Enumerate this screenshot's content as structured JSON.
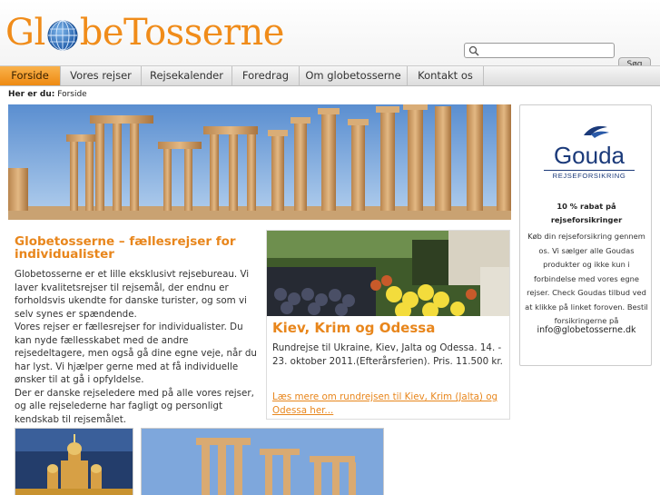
{
  "header": {
    "logo_text_left": "Gl",
    "logo_text_right": "beTosserne",
    "search_placeholder": "",
    "search_button": "Søg"
  },
  "nav": {
    "items": [
      "Forside",
      "Vores rejser",
      "Rejsekalender",
      "Foredrag",
      "Om globetosserne",
      "Kontakt os"
    ]
  },
  "breadcrumb": {
    "label": "Her er du:",
    "current": "Forside"
  },
  "intro": {
    "title": "Globetosserne – fællesrejser for individualister",
    "p1": "Globetosserne er et lille eksklusivt rejsebureau. Vi laver kvalitetsrejser til rejsemål, der endnu er forholdsvis ukendte for danske turister, og som vi selv synes er spændende.",
    "p2": "Vores rejser er fællesrejser for individualister. Du kan nyde fællesskabet med de andre rejsedeltagere, men også gå dine egne veje, når du har lyst. Vi hjælper gerne med at få individuelle ønsker til at gå i opfyldelse.",
    "p3": "Der er danske rejseledere med på alle vores rejser, og alle rejselederne har fagligt og personligt kendskab til rejsemålet."
  },
  "trip": {
    "title": "Kiev, Krim og Odessa",
    "description": "Rundrejse til Ukraine, Kiev, Jalta og Odessa. 14. - 23. oktober 2011.(Efterårsferien). Pris. 11.500 kr.",
    "link": "Læs mere om rundrejsen til Kiev, Krim (Jalta) og Odessa her..."
  },
  "sidebar": {
    "brand": "Gouda",
    "brand_sub": "REJSEFORSIKRING",
    "heading": "10 % rabat på rejseforsikringer",
    "text": "Køb din rejseforsikring gennem os. Vi sælger alle Goudas produkter og ikke kun i forbindelse med vores egne rejser. Check Goudas tilbud ved at klikke på linket foroven. Bestil forsikringerne på",
    "email": "info@globetosserne.dk"
  },
  "colors": {
    "accent": "#e8861c",
    "nav_active": "#ee8a12",
    "gouda_blue": "#1b3a7a"
  }
}
